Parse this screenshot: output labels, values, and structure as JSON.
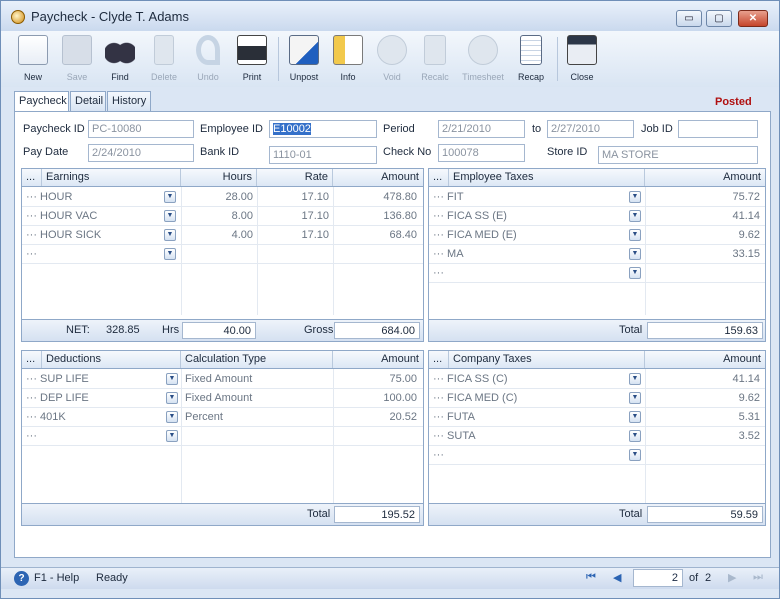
{
  "window": {
    "title": "Paycheck - Clyde T. Adams",
    "controls": {
      "minimize": "▭",
      "maximize": "▢",
      "close": "✕"
    }
  },
  "toolbar": {
    "new": "New",
    "save": "Save",
    "find": "Find",
    "delete": "Delete",
    "undo": "Undo",
    "print": "Print",
    "unpost": "Unpost",
    "info": "Info",
    "void": "Void",
    "recalc": "Recalc",
    "timesheet": "Timesheet",
    "recap": "Recap",
    "close": "Close"
  },
  "tabs": [
    {
      "label": "Paycheck"
    },
    {
      "label": "Detail"
    },
    {
      "label": "History"
    }
  ],
  "status_badge": "Posted",
  "header": {
    "paycheck_id_label": "Paycheck ID",
    "paycheck_id": "PC-10080",
    "employee_id_label": "Employee ID",
    "employee_id": "E10002",
    "period_label": "Period",
    "period_from": "2/21/2010",
    "period_to_label": "to",
    "period_to": "2/27/2010",
    "job_id_label": "Job ID",
    "job_id": "",
    "pay_date_label": "Pay Date",
    "pay_date": "2/24/2010",
    "bank_id_label": "Bank ID",
    "bank_id": "1110-01",
    "check_no_label": "Check No",
    "check_no": "100078",
    "store_id_label": "Store ID",
    "store_id": "MA STORE"
  },
  "earnings": {
    "headers": {
      "menu": "...",
      "name": "Earnings",
      "hours": "Hours",
      "rate": "Rate",
      "amount": "Amount"
    },
    "rows": [
      {
        "name": "HOUR",
        "hours": "28.00",
        "rate": "17.10",
        "amount": "478.80"
      },
      {
        "name": "HOUR VAC",
        "hours": "8.00",
        "rate": "17.10",
        "amount": "136.80"
      },
      {
        "name": "HOUR SICK",
        "hours": "4.00",
        "rate": "17.10",
        "amount": "68.40"
      },
      {
        "name": "",
        "hours": "",
        "rate": "",
        "amount": ""
      }
    ],
    "net_label": "NET:",
    "net": "328.85",
    "hrs_label": "Hrs",
    "hrs": "40.00",
    "gross_label": "Gross",
    "gross": "684.00"
  },
  "employee_taxes": {
    "headers": {
      "menu": "...",
      "name": "Employee Taxes",
      "amount": "Amount"
    },
    "rows": [
      {
        "name": "FIT",
        "amount": "75.72"
      },
      {
        "name": "FICA SS (E)",
        "amount": "41.14"
      },
      {
        "name": "FICA MED (E)",
        "amount": "9.62"
      },
      {
        "name": "MA",
        "amount": "33.15"
      },
      {
        "name": "",
        "amount": ""
      }
    ],
    "total_label": "Total",
    "total": "159.63"
  },
  "deductions": {
    "headers": {
      "menu": "...",
      "name": "Deductions",
      "calc": "Calculation Type",
      "amount": "Amount"
    },
    "rows": [
      {
        "name": "SUP LIFE",
        "calc": "Fixed Amount",
        "amount": "75.00"
      },
      {
        "name": "DEP LIFE",
        "calc": "Fixed Amount",
        "amount": "100.00"
      },
      {
        "name": "401K",
        "calc": "Percent",
        "amount": "20.52"
      },
      {
        "name": "",
        "calc": "",
        "amount": ""
      }
    ],
    "total_label": "Total",
    "total": "195.52"
  },
  "company_taxes": {
    "headers": {
      "menu": "...",
      "name": "Company Taxes",
      "amount": "Amount"
    },
    "rows": [
      {
        "name": "FICA SS (C)",
        "amount": "41.14"
      },
      {
        "name": "FICA MED (C)",
        "amount": "9.62"
      },
      {
        "name": "FUTA",
        "amount": "5.31"
      },
      {
        "name": "SUTA",
        "amount": "3.52"
      },
      {
        "name": "",
        "amount": ""
      }
    ],
    "total_label": "Total",
    "total": "59.59"
  },
  "statusbar": {
    "help": "F1 - Help",
    "state": "Ready",
    "page": "2",
    "of_label": "of",
    "page_count": "2"
  }
}
